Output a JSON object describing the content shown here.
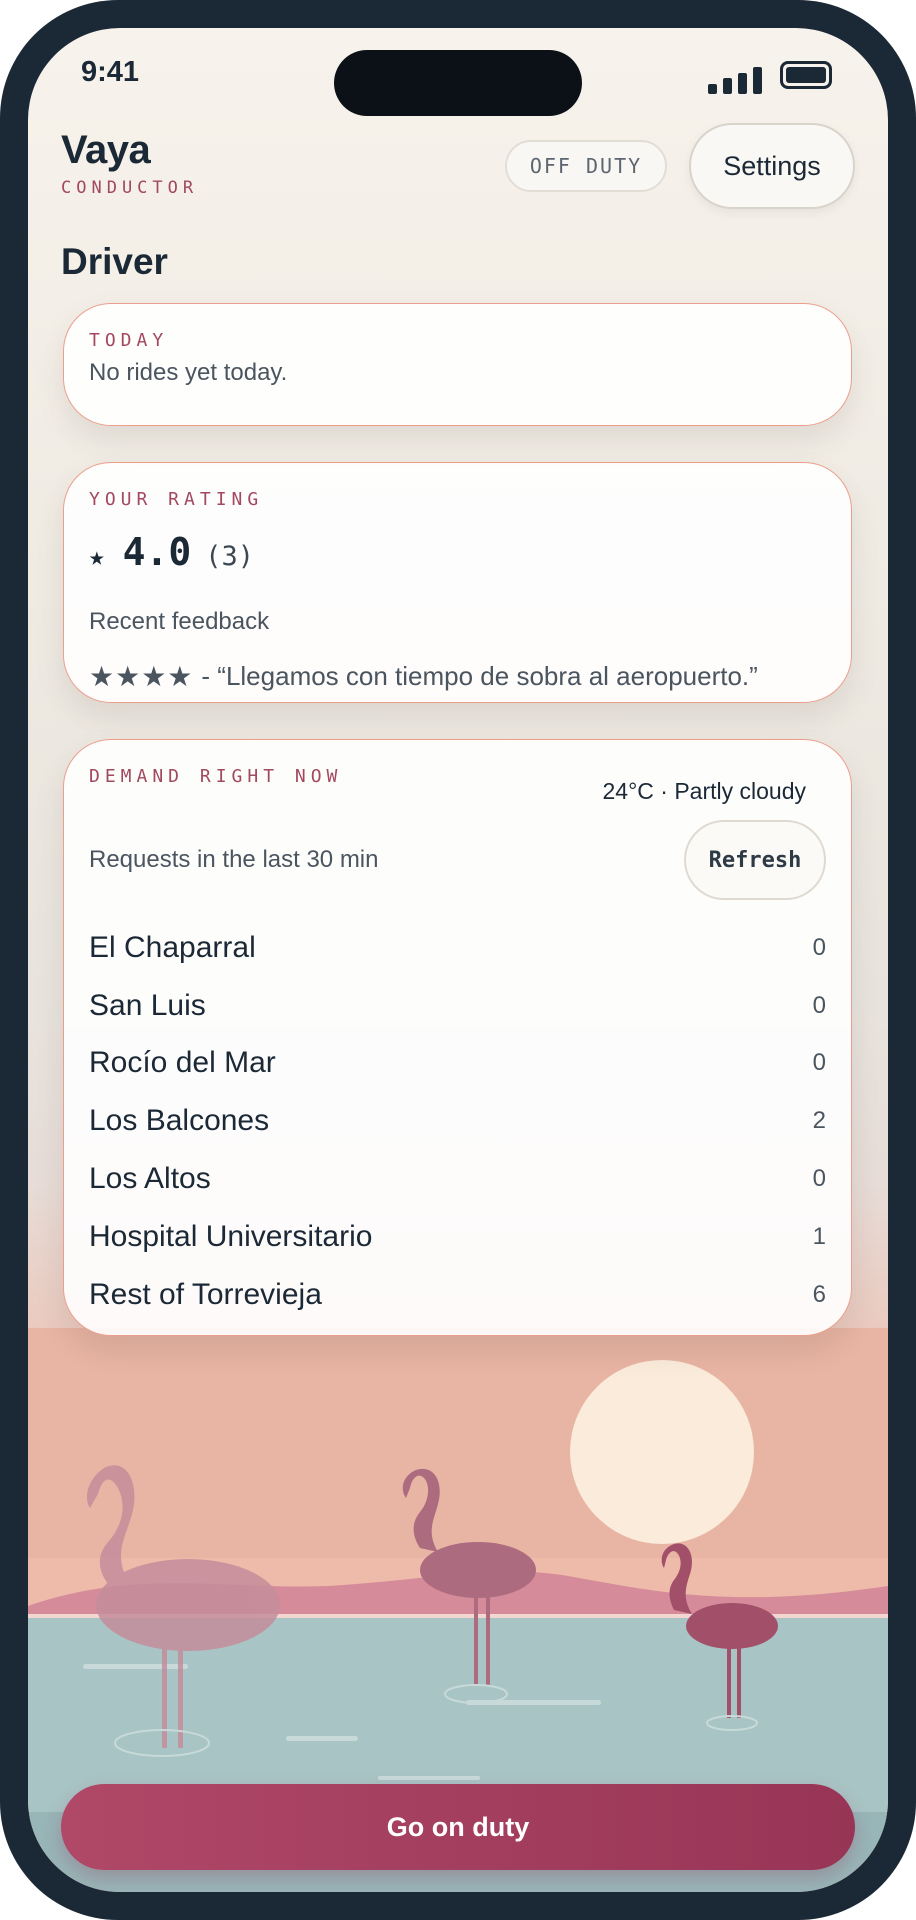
{
  "status_bar": {
    "time": "9:41"
  },
  "header": {
    "app_name": "Vaya",
    "app_subtitle": "CONDUCTOR",
    "status_badge": "OFF DUTY",
    "settings_label": "Settings"
  },
  "page_title": "Driver",
  "today": {
    "label": "TODAY",
    "text": "No rides yet today."
  },
  "rating": {
    "label": "YOUR RATING",
    "star": "★",
    "value": "4.0",
    "count": "(3)",
    "feedback_label": "Recent feedback",
    "feedback_stars": "★★★★",
    "feedback_text": "- “Llegamos con tiempo de sobra al aeropuerto.”"
  },
  "demand": {
    "label": "DEMAND RIGHT NOW",
    "weather": "24°C · Partly cloudy",
    "requests_label": "Requests in the last 30 min",
    "refresh_label": "Refresh",
    "zones": [
      {
        "name": "El Chaparral",
        "count": "0"
      },
      {
        "name": "San Luis",
        "count": "0"
      },
      {
        "name": "Rocío del Mar",
        "count": "0"
      },
      {
        "name": "Los Balcones",
        "count": "2"
      },
      {
        "name": "Los Altos",
        "count": "0"
      },
      {
        "name": "Hospital Universitario",
        "count": "1"
      },
      {
        "name": "Rest of Torrevieja",
        "count": "6"
      }
    ]
  },
  "primary_action": {
    "label": "Go on duty"
  },
  "colors": {
    "accent": "#a2485f",
    "button": "#a63f60",
    "text": "#1b2836",
    "water": "#a9c4c5",
    "sun": "#fbeedd",
    "flamingo": "#a5566f"
  },
  "icons": [
    "signal-icon",
    "battery-icon",
    "star-icon"
  ]
}
